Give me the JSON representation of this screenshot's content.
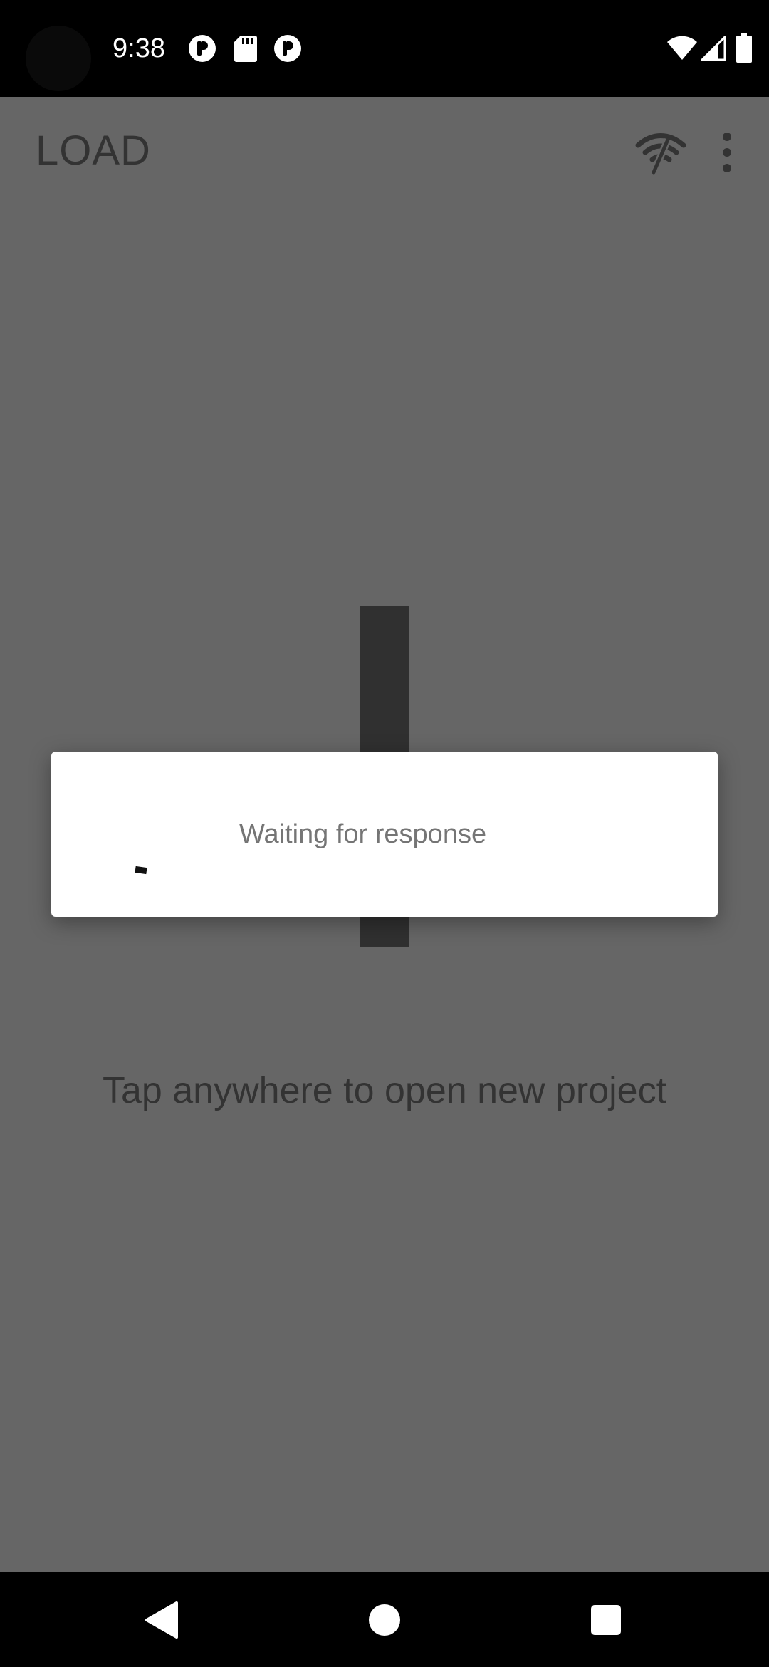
{
  "status_bar": {
    "time": "9:38",
    "left_icons": [
      "notification-p-icon",
      "sd-card-icon",
      "notification-p-icon"
    ],
    "right_icons": [
      "wifi-icon",
      "cell-signal-icon",
      "battery-icon"
    ]
  },
  "app_bar": {
    "title": "LOAD",
    "actions": [
      "wifi-off-icon",
      "more-vert-icon"
    ]
  },
  "main": {
    "hint": "Tap anywhere to open new project"
  },
  "dialog": {
    "message": "Waiting for response"
  },
  "nav_bar": {
    "buttons": [
      "back-icon",
      "home-icon",
      "recents-icon"
    ]
  },
  "colors": {
    "scrim_background": "#666666",
    "dialog_background": "#ffffff",
    "title_text": "#333333",
    "dialog_text": "#757575",
    "bar_background": "#000000"
  }
}
